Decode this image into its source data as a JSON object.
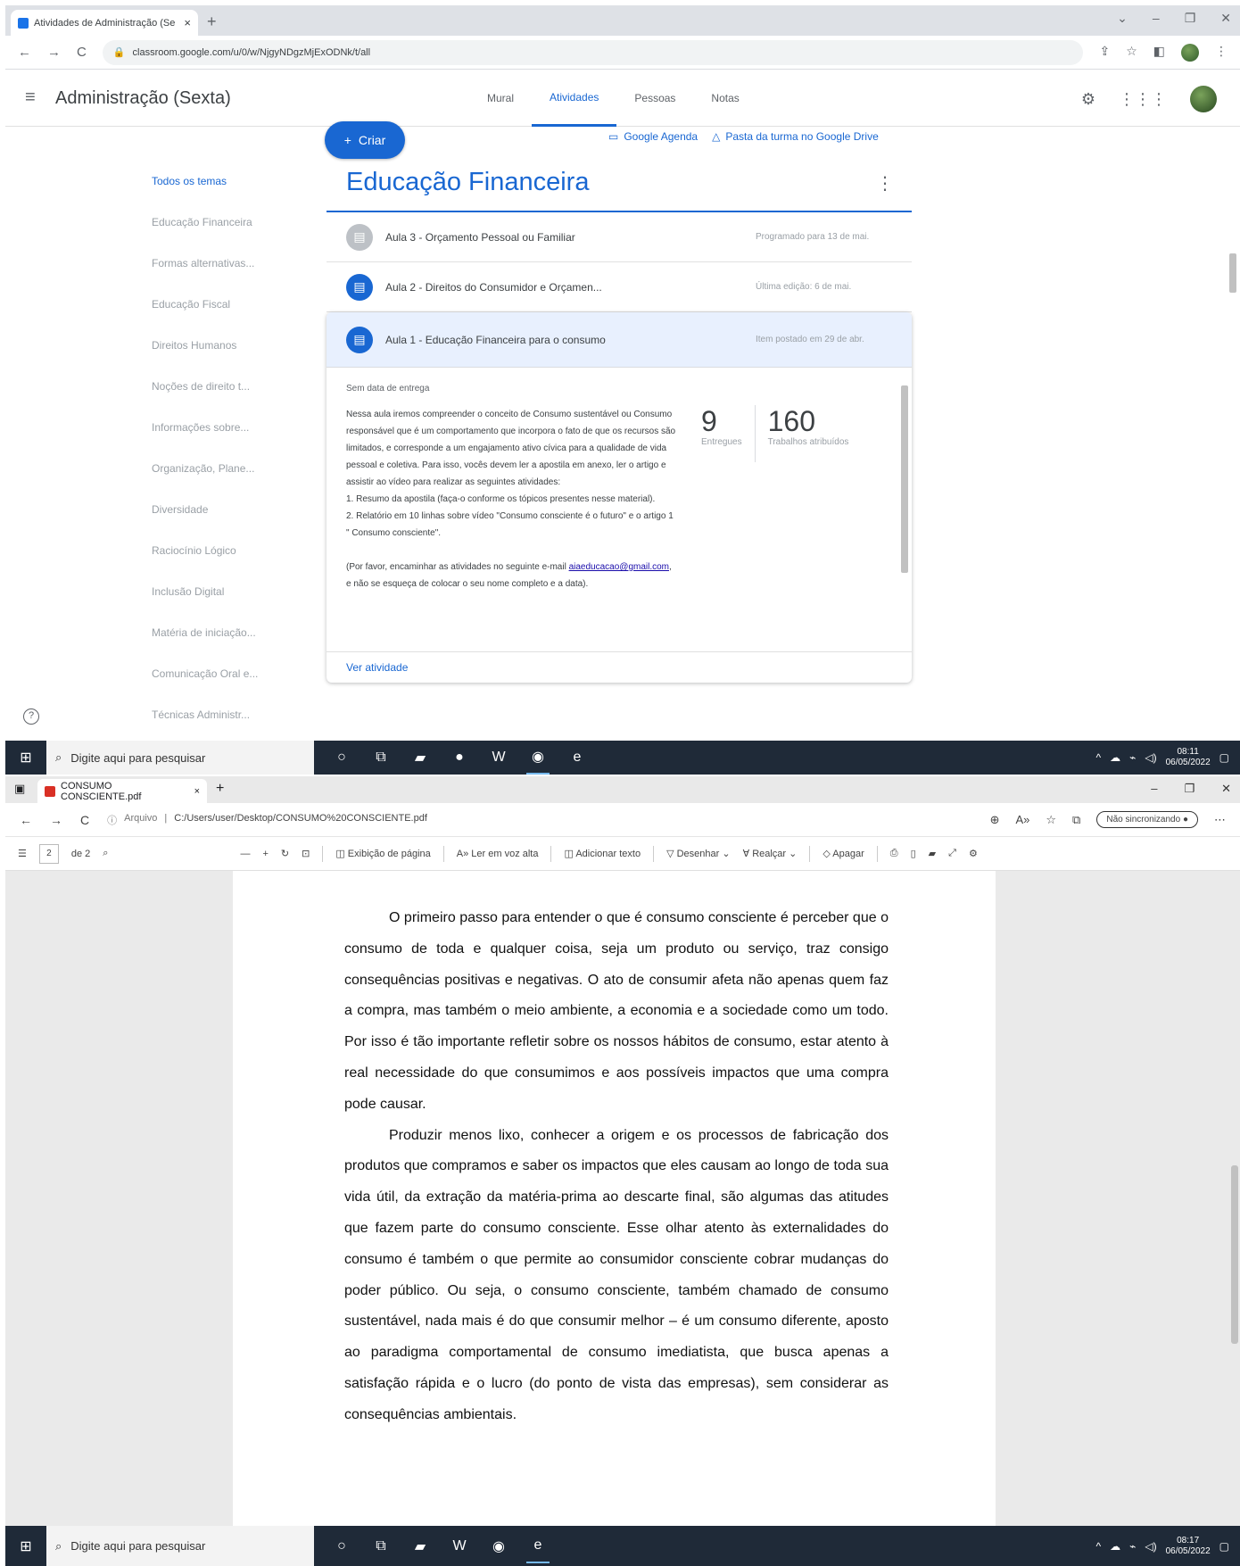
{
  "chrome": {
    "tab_title": "Atividades de Administração (Se",
    "url": "classroom.google.com/u/0/w/NjgyNDgzMjExODNk/t/all"
  },
  "classroom": {
    "class_title": "Administração (Sexta)",
    "nav": [
      "Mural",
      "Atividades",
      "Pessoas",
      "Notas"
    ],
    "create_label": "Criar",
    "calendar_link": "Google Agenda",
    "drive_link": "Pasta da turma no Google Drive",
    "topics": [
      "Todos os temas",
      "Educação Financeira",
      "Formas alternativas...",
      "Educação Fiscal",
      "Direitos Humanos",
      "Noções de direito t...",
      "Informações sobre...",
      "Organização, Plane...",
      "Diversidade",
      "Raciocínio Lógico",
      "Inclusão Digital",
      "Matéria de iniciação...",
      "Comunicação Oral e...",
      "Técnicas Administr..."
    ],
    "section_title": "Educação Financeira",
    "items": [
      {
        "title": "Aula 3 - Orçamento Pessoal ou Familiar",
        "meta": "Programado para 13 de mai."
      },
      {
        "title": "Aula 2 - Direitos do Consumidor e Orçamen...",
        "meta": "Última edição: 6 de mai."
      },
      {
        "title": "Aula 1 - Educação Financeira para o consumo",
        "meta": "Item postado em 29 de abr."
      }
    ],
    "expanded": {
      "due": "Sem data de entrega",
      "desc1": "Nessa aula iremos compreender o conceito de Consumo sustentável ou Consumo responsável que é um comportamento que incorpora o fato de que os recursos são limitados, e corresponde a um engajamento ativo cívica para a qualidade de vida pessoal e coletiva. Para isso, vocês devem ler a apostila em anexo, ler o artigo e assistir ao vídeo para realizar as seguintes atividades:",
      "desc2": "1. Resumo da apostila (faça-o conforme os tópicos presentes nesse material).",
      "desc3": "2. Relatório em 10 linhas sobre vídeo \"Consumo consciente é o futuro\" e o artigo 1 \" Consumo consciente\".",
      "desc4_a": "(Por favor, encaminhar as atividades no seguinte e-mail",
      "email": "aiaeducacao@gmail.com",
      "desc4_b": ", e não se esqueça de colocar o seu nome completo e a data).",
      "handed_in": "9",
      "handed_in_label": "Entregues",
      "assigned": "160",
      "assigned_label": "Trabalhos atribuídos",
      "view_link": "Ver atividade"
    }
  },
  "taskbar": {
    "search_placeholder": "Digite aqui para pesquisar",
    "time_top": "08:11",
    "date_top": "06/05/2022",
    "time_bottom": "08:17",
    "date_bottom": "06/05/2022"
  },
  "edge": {
    "tab_title": "CONSUMO CONSCIENTE.pdf",
    "url_prefix": "Arquivo",
    "url": "C:/Users/user/Desktop/CONSUMO%20CONSCIENTE.pdf",
    "sync_label": "Não sincronizando",
    "page_current": "2",
    "page_total": "de 2",
    "tools": [
      "Exibição de página",
      "Ler em voz alta",
      "Adicionar texto",
      "Desenhar",
      "Realçar",
      "Apagar"
    ]
  },
  "pdf": {
    "para1": "O primeiro passo para entender o que é consumo consciente é perceber que o consumo de toda e qualquer coisa, seja um produto ou serviço, traz consigo consequências positivas e negativas. O ato de consumir afeta não apenas quem faz a compra, mas também o meio ambiente, a economia e a sociedade como um todo. Por isso é tão importante refletir sobre os nossos hábitos de consumo, estar atento à real necessidade do que consumimos e aos possíveis impactos que uma compra pode causar.",
    "para2": "Produzir menos lixo, conhecer a origem e os processos de fabricação dos produtos que compramos e saber os impactos que eles causam ao longo de toda sua vida útil, da extração da matéria-prima ao descarte final, são algumas das atitudes que fazem parte do consumo consciente. Esse olhar atento às externalidades do consumo é também o que permite ao consumidor consciente cobrar mudanças do poder público. Ou seja, o consumo consciente, também chamado de consumo sustentável, nada mais é do que consumir melhor – é um consumo diferente, aposto ao paradigma comportamental de consumo imediatista, que busca apenas a satisfação rápida e o lucro (do ponto de vista das empresas), sem considerar as consequências ambientais."
  }
}
